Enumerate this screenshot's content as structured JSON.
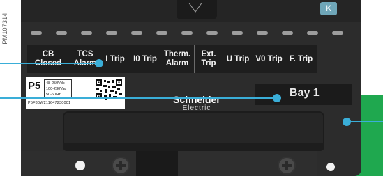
{
  "figure_ref": "PM107314",
  "leds_count_visible": 13,
  "indicator_labels": [
    {
      "text": "CB\nClosed"
    },
    {
      "text": "TCS\nAlarm"
    },
    {
      "text": "I Trip"
    },
    {
      "text": "I0 Trip"
    },
    {
      "text": "Therm.\nAlarm"
    },
    {
      "text": "Ext.\nTrip"
    },
    {
      "text": "U Trip"
    },
    {
      "text": "V0 Trip"
    },
    {
      "text": "F. Trip"
    },
    {
      "text": ""
    }
  ],
  "product_label": {
    "model": "P5",
    "voltage_lines": "48-250Vdc\n100-230Vac\n50-60Hz",
    "serial": "P5F30W211647230001"
  },
  "bay_label": "Bay 1",
  "brand": {
    "name": "Schneider",
    "sub": "Electric"
  },
  "colors": {
    "callout": "#3aaed8",
    "device_body": "#2c2c2c",
    "green_panel": "#1fa84f",
    "hmi_button": "#6fa6b8"
  }
}
